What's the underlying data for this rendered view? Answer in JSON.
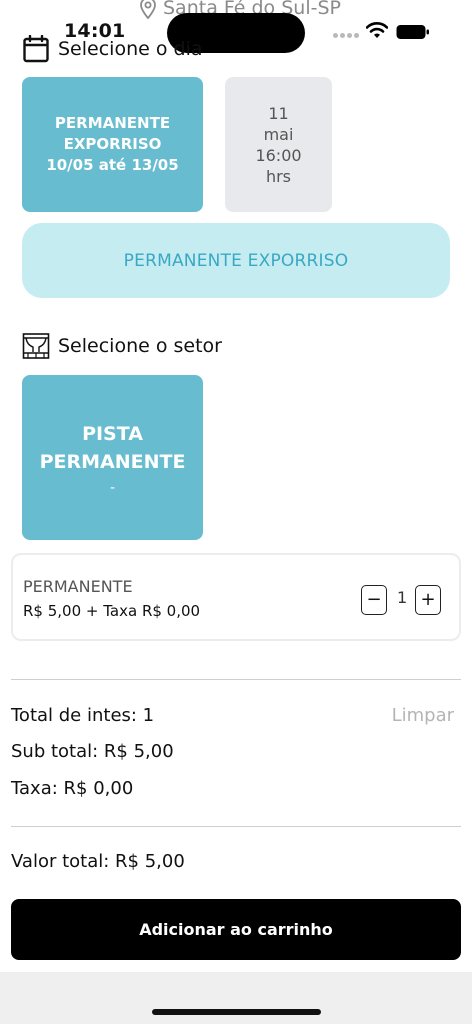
{
  "status_bar": {
    "time": "14:01"
  },
  "location": {
    "text": "Santa Fé do Sul-SP"
  },
  "day_section": {
    "title": "Selecione o dia"
  },
  "day_options": [
    {
      "lines": [
        "PERMANENTE",
        "EXPORRISO",
        "10/05 até 13/05"
      ],
      "selected": true
    },
    {
      "lines": [
        "11",
        "mai",
        "16:00",
        "hrs"
      ],
      "selected": false
    }
  ],
  "event_banner": {
    "text": "PERMANENTE EXPORRISO"
  },
  "sector_section": {
    "title": "Selecione o setor"
  },
  "sector": {
    "name_lines": [
      "PISTA",
      "PERMANENTE"
    ],
    "sub": "-"
  },
  "ticket": {
    "name": "PERMANENTE",
    "price": "R$ 5,00 + Taxa R$ 0,00",
    "minus": "−",
    "quantity": "1",
    "plus": "+"
  },
  "summary": {
    "total_items": "Total de intes: 1",
    "clear": "Limpar",
    "subtotal": "Sub total: R$ 5,00",
    "fee": "Taxa: R$ 0,00",
    "grand_total": "Valor total: R$ 5,00"
  },
  "cart_button": {
    "label": "Adicionar ao carrinho"
  },
  "colors": {
    "accent": "#67bccf",
    "banner_bg": "#c5ecf1",
    "banner_text": "#3aa8c4"
  }
}
